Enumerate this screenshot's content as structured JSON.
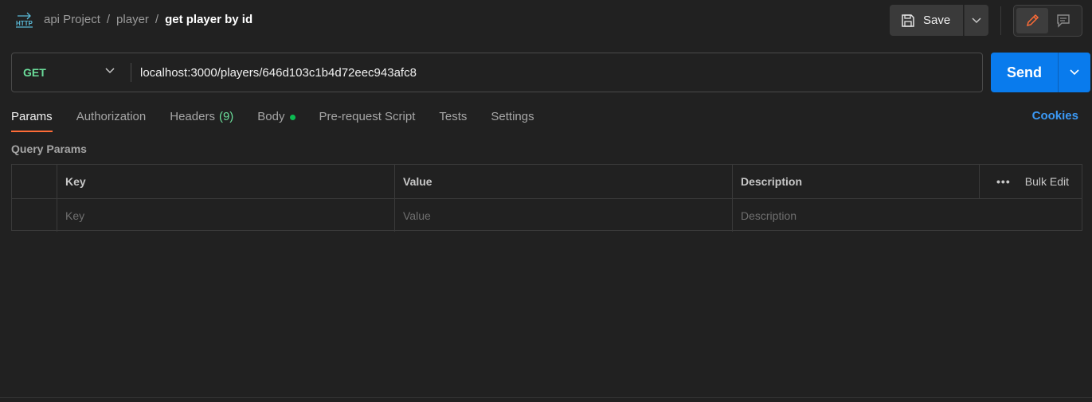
{
  "breadcrumb": {
    "icon": "http-icon",
    "collection": "api Project",
    "folder": "player",
    "request": "get player by id",
    "separator": "/"
  },
  "toolbar": {
    "save_label": "Save"
  },
  "request": {
    "method": "GET",
    "url": "localhost:3000/players/646d103c1b4d72eec943afc8",
    "send_label": "Send"
  },
  "tabs": [
    {
      "label": "Params",
      "active": true
    },
    {
      "label": "Authorization"
    },
    {
      "label": "Headers",
      "count": "(9)"
    },
    {
      "label": "Body",
      "indicator": "dot"
    },
    {
      "label": "Pre-request Script"
    },
    {
      "label": "Tests"
    },
    {
      "label": "Settings"
    }
  ],
  "cookies_label": "Cookies",
  "query_params": {
    "title": "Query Params",
    "headers": {
      "key": "Key",
      "value": "Value",
      "description": "Description"
    },
    "bulk_edit": "Bulk Edit",
    "more": "•••",
    "placeholders": {
      "key": "Key",
      "value": "Value",
      "description": "Description"
    }
  },
  "colors": {
    "background": "#212121",
    "method_get": "#6bdd9a",
    "send": "#097bed",
    "active_tab": "#ff6c37",
    "cookies": "#3b99f5",
    "body_dot": "#0cbb52"
  }
}
